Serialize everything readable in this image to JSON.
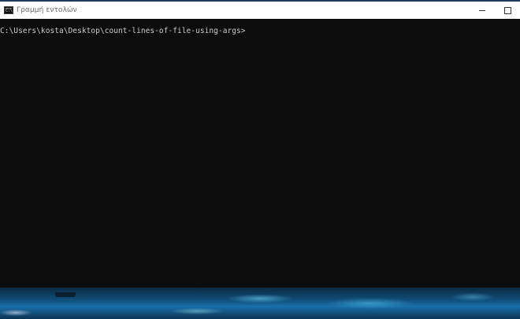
{
  "window": {
    "title": "Γραμμή εντολών",
    "icon": "cmd-icon",
    "icon_text": "C:\\"
  },
  "controls": {
    "minimize": "minimize-icon",
    "maximize": "maximize-icon"
  },
  "console": {
    "prompt": "C:\\Users\\kosta\\Desktop\\count-lines-of-file-using-args>"
  },
  "colors": {
    "console_bg": "#0c0c0c",
    "console_text": "#cccccc",
    "titlebar_bg": "#ffffff"
  }
}
